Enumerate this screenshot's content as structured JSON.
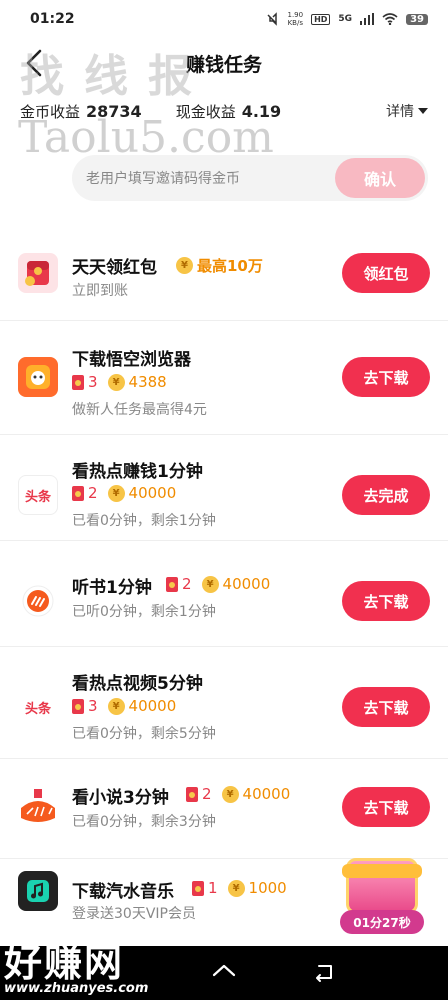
{
  "status_bar": {
    "time": "01:22",
    "speed_value": "1.90",
    "speed_unit": "KB/s",
    "hd": "HD",
    "network": "5G",
    "battery": "39"
  },
  "header": {
    "title": "赚钱任务"
  },
  "stats": {
    "coin_label": "金币收益",
    "coin_value": "28734",
    "cash_label": "现金收益",
    "cash_value": "4.19",
    "detail_label": "详情"
  },
  "invite": {
    "placeholder": "老用户填写邀请码得金币",
    "confirm_label": "确认"
  },
  "tasks": [
    {
      "title": "天天领红包",
      "coin_prefix": "¥",
      "reward_text": "最高10万",
      "subtitle": "立即到账",
      "button": "领红包"
    },
    {
      "title": "下载悟空浏览器",
      "redpacket_count": "3",
      "coin_value": "4388",
      "subtitle": "做新人任务最高得4元",
      "button": "去下载"
    },
    {
      "title": "看热点赚钱1分钟",
      "redpacket_count": "2",
      "coin_value": "40000",
      "subtitle": "已看0分钟，剩余1分钟",
      "button": "去完成",
      "icon_text": "头条"
    },
    {
      "title": "听书1分钟",
      "redpacket_count": "2",
      "coin_value": "40000",
      "subtitle": "已听0分钟，剩余1分钟",
      "button": "去下载"
    },
    {
      "title": "看热点视频5分钟",
      "redpacket_count": "3",
      "coin_value": "40000",
      "subtitle": "已看0分钟，剩余5分钟",
      "button": "去下载",
      "icon_text": "头条"
    },
    {
      "title": "看小说3分钟",
      "redpacket_count": "2",
      "coin_value": "40000",
      "subtitle": "已看0分钟，剩余3分钟",
      "button": "去下载"
    },
    {
      "title": "下载汽水音乐",
      "redpacket_count": "1",
      "coin_value": "1000",
      "subtitle": "登录送30天VIP会员",
      "button": "去下载"
    }
  ],
  "chest": {
    "timer": "01分27秒"
  },
  "watermarks": {
    "top_cn": "找线报",
    "top_en": "Taolu5.com",
    "bottom_cn": "好赚网",
    "bottom_en": "www.zhuanyes.com"
  },
  "colors": {
    "accent": "#f1304f",
    "confirm_disabled": "#f8b9c2",
    "gold": "#f08c00",
    "red": "#e8384a"
  }
}
